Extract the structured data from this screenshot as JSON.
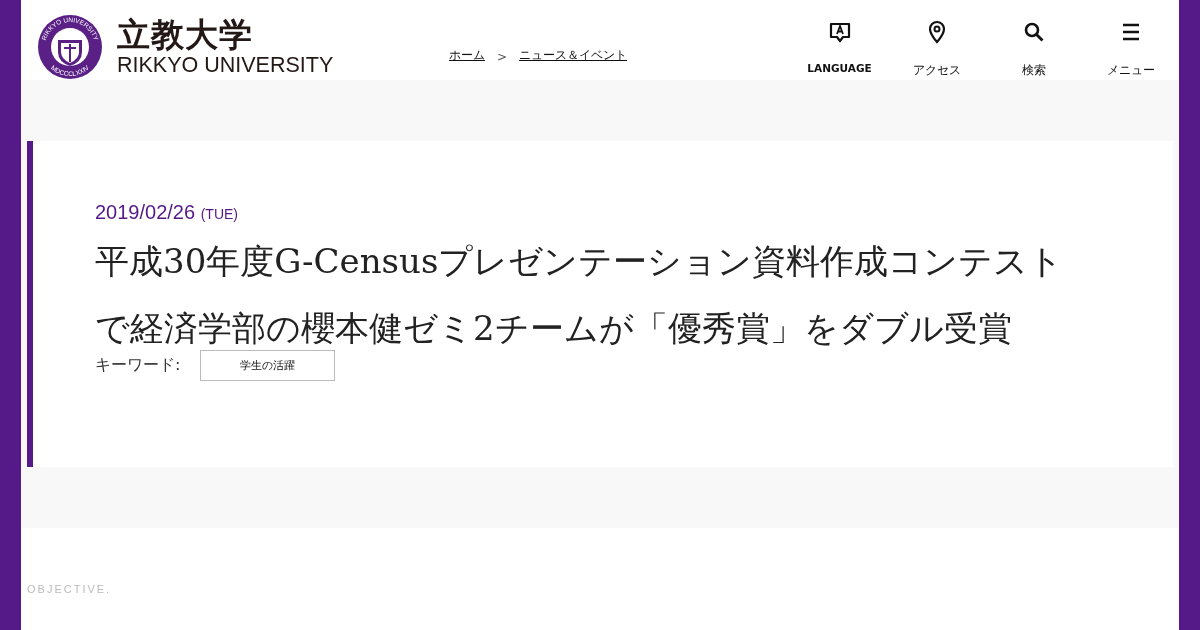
{
  "header": {
    "logo": {
      "name_ja": "立教大学",
      "name_en": "RIKKYO UNIVERSITY",
      "seal_top": "RIKKYO UNIVERSITY",
      "seal_bottom": "MDCCCLXXIV"
    },
    "breadcrumbs": [
      {
        "label": "ホーム"
      },
      {
        "label": "ニュース＆イベント"
      }
    ],
    "breadcrumb_separator": ">",
    "nav": [
      {
        "kind": "language",
        "label": "LANGUAGE"
      },
      {
        "kind": "access",
        "label": "アクセス"
      },
      {
        "kind": "search",
        "label": "検索"
      },
      {
        "kind": "menu",
        "label": "メニュー"
      }
    ]
  },
  "article": {
    "date": "2019/02/26",
    "weekday": "(TUE)",
    "title": "平成30年度G-Censusプレゼンテーション資料作成コンテストで経済学部の櫻本健ゼミ2チームが「優秀賞」をダブル受賞",
    "keywords_label": "キーワード:",
    "keywords": [
      "学生の活躍"
    ]
  },
  "footer_text": "OBJECTIVE."
}
